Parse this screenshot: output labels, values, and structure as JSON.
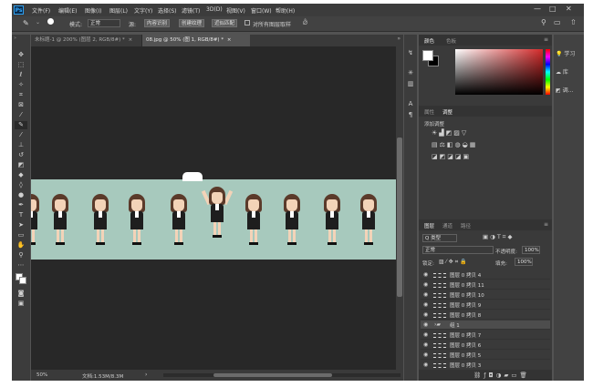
{
  "app": {
    "logo": "Ps"
  },
  "menu": [
    "文件(F)",
    "编辑(E)",
    "图像(I)",
    "图层(L)",
    "文字(Y)",
    "选择(S)",
    "滤镜(T)",
    "3D(D)",
    "视图(V)",
    "窗口(W)",
    "帮助(H)"
  ],
  "window_controls": {
    "minimize": "—",
    "restore": "□",
    "close": "✕"
  },
  "options": {
    "mode_label": "模式:",
    "mode_value": "正常",
    "source_label": "源:",
    "content_aware_btn": "内容识别",
    "create_texture_btn": "创建纹理",
    "proximity_match_btn": "近似匹配",
    "sample_all_layers_label": "对所有图层取样"
  },
  "tabs": [
    {
      "label": "未标题-1 @ 200% (图层 2, RGB/8#) *",
      "close": "×"
    },
    {
      "label": "08.jpg @ 50% (图 1, RGB/8#) *",
      "close": "×"
    }
  ],
  "status": {
    "zoom": "50%",
    "doc": "文档:1.53M/8.3M",
    "arrow": "›"
  },
  "color_panel": {
    "tabs": [
      "颜色",
      "色板"
    ],
    "colors": {
      "fg": "#ffffff",
      "bg": "#000000",
      "accent": "#d42a2a"
    }
  },
  "adjust_panel": {
    "tabs": [
      "属性",
      "调整"
    ],
    "title": "添加调整"
  },
  "layers_panel": {
    "tabs": [
      "图层",
      "通道",
      "路径"
    ],
    "kind_label": "Q 类型",
    "blend_mode": "正常",
    "opacity_label": "不透明度:",
    "opacity_value": "100%",
    "lock_label": "锁定:",
    "fill_label": "填充:",
    "fill_value": "100%",
    "layers": [
      {
        "name": "图层 0 拷贝 4",
        "selected": false
      },
      {
        "name": "图层 0 拷贝 11",
        "selected": false
      },
      {
        "name": "图层 0 拷贝 10",
        "selected": false
      },
      {
        "name": "图层 0 拷贝 9",
        "selected": false
      },
      {
        "name": "图层 0 拷贝 8",
        "selected": false
      },
      {
        "name": "组 1",
        "selected": true
      },
      {
        "name": "图层 0 拷贝 7",
        "selected": false
      },
      {
        "name": "图层 0 拷贝 6",
        "selected": false
      },
      {
        "name": "图层 0 拷贝 5",
        "selected": false
      },
      {
        "name": "图层 0 拷贝 3",
        "selected": false
      }
    ]
  },
  "learn_panel": {
    "items": [
      "学习",
      "库",
      "调..."
    ]
  }
}
